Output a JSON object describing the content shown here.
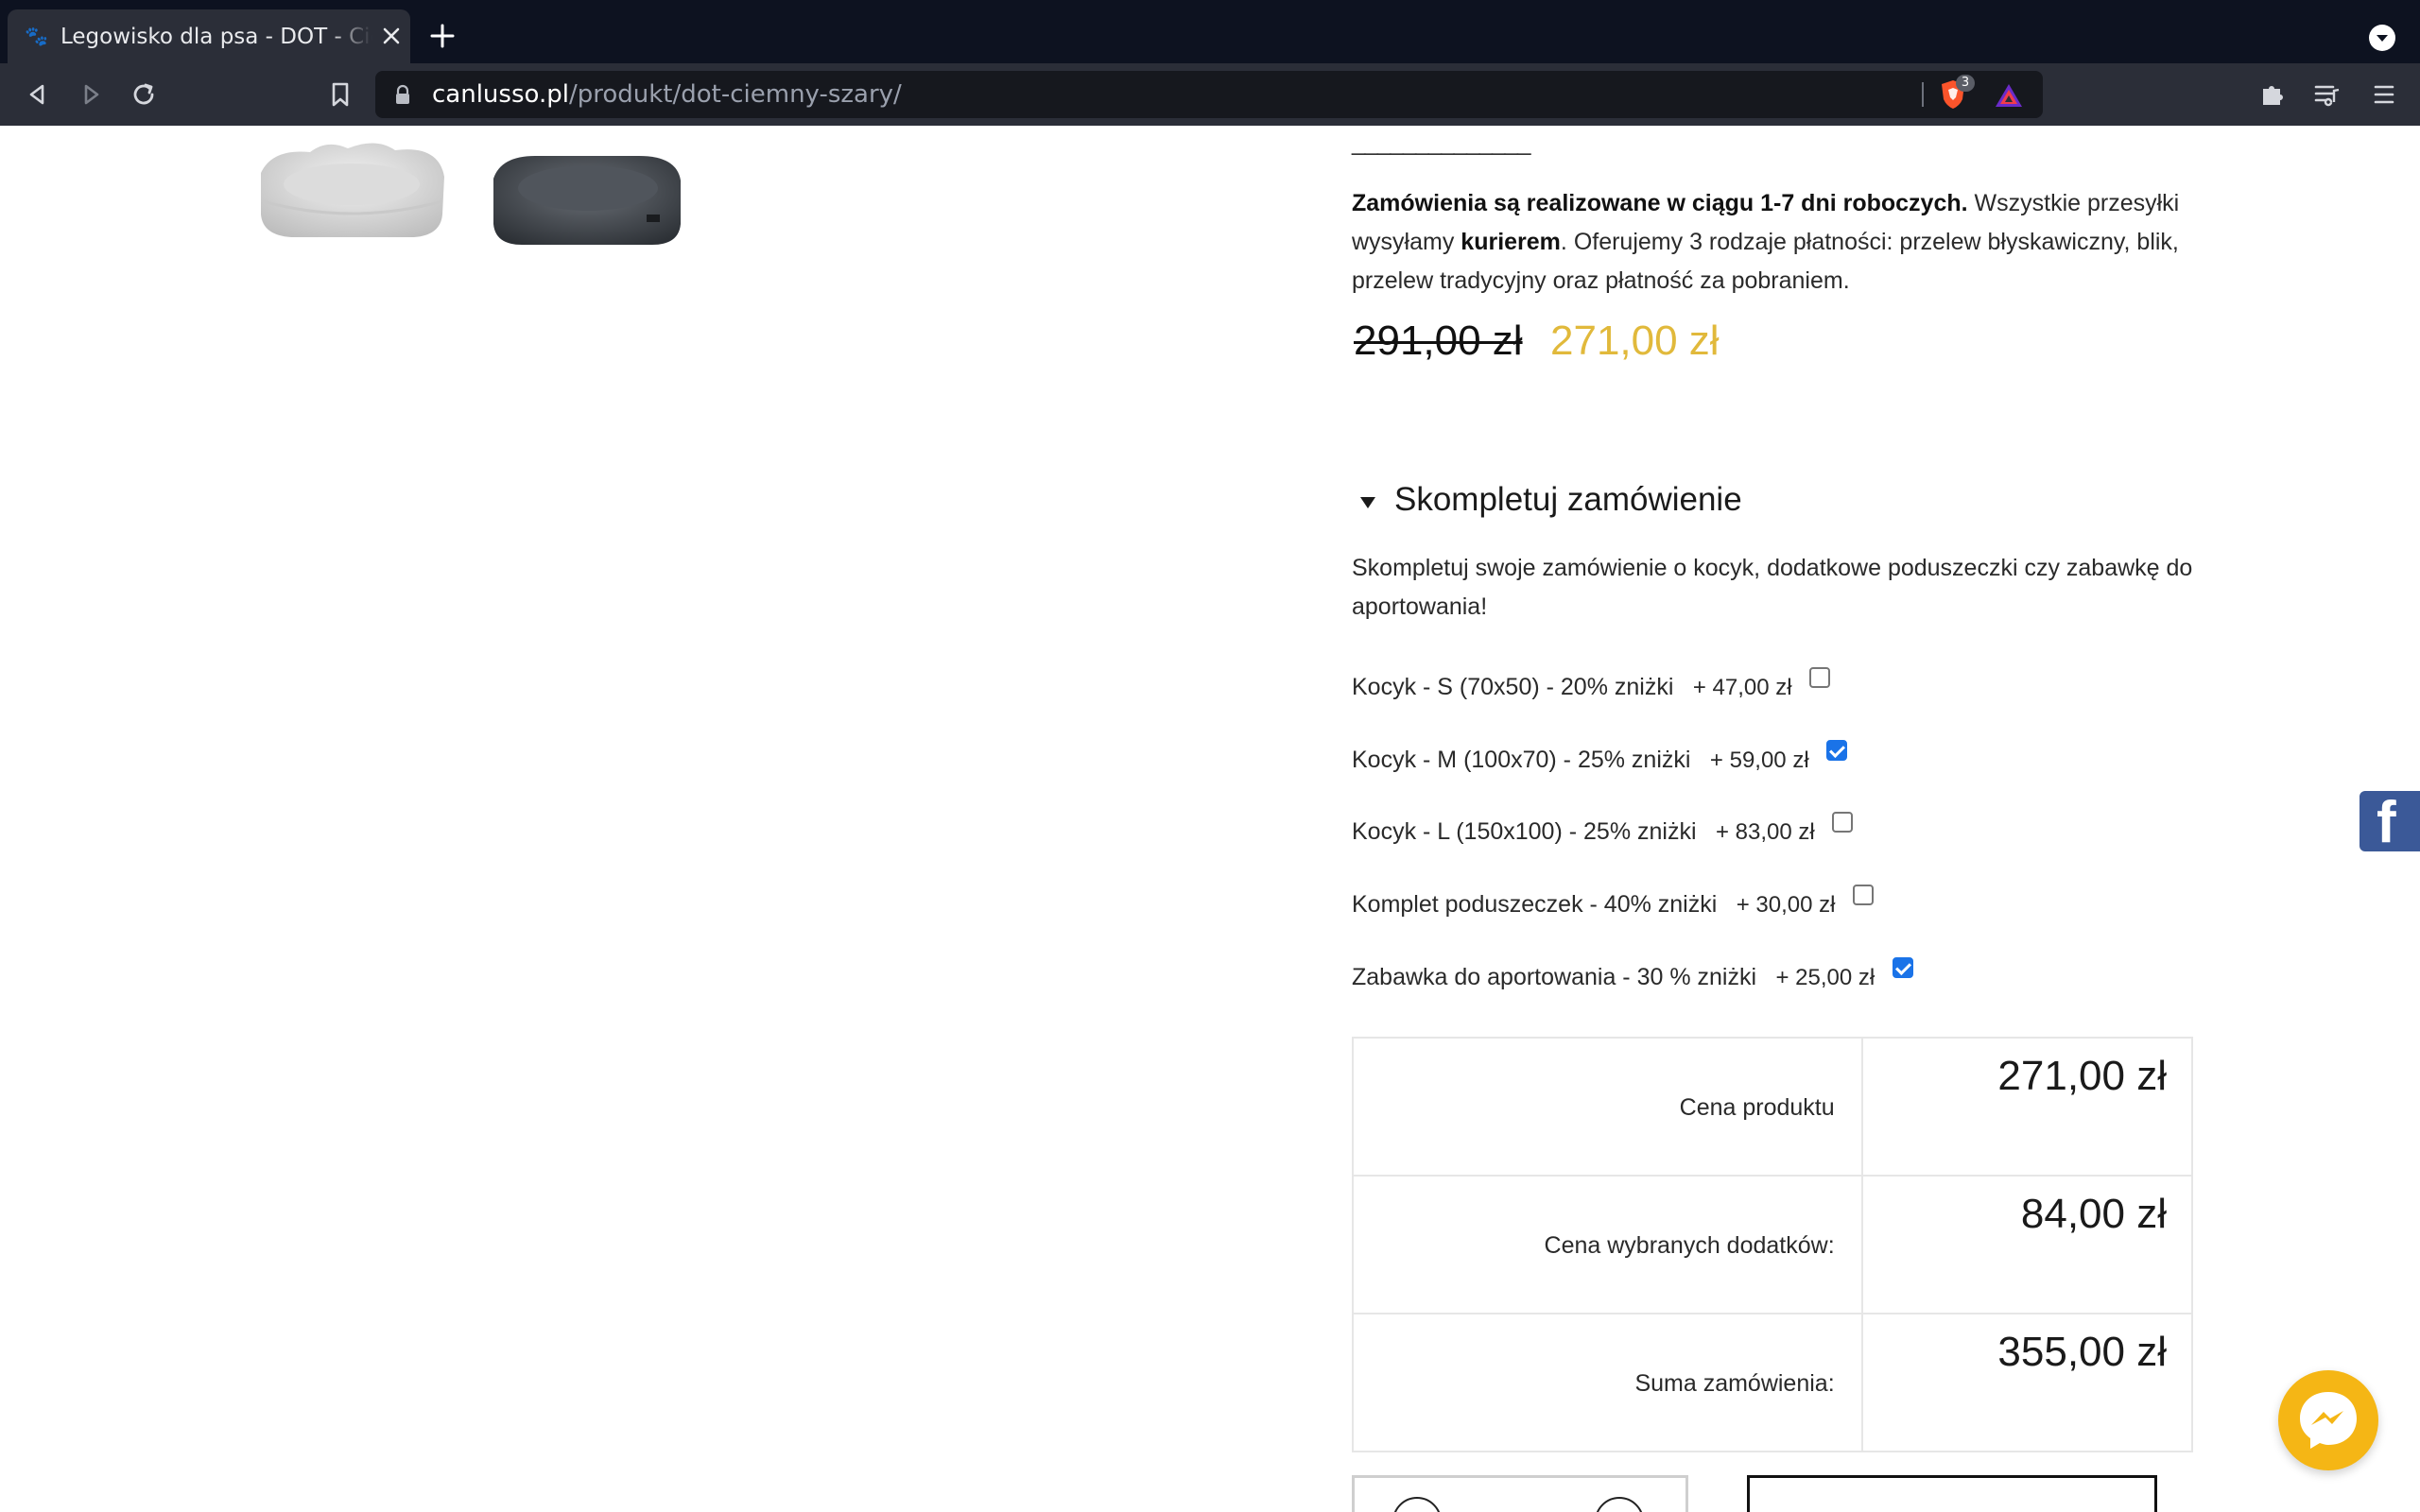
{
  "browser": {
    "tab_title": "Legowisko dla psa - DOT - Ciemny szary",
    "url_host": "canlusso.pl",
    "url_path": "/produkt/dot-ciemny-szary/",
    "shield_count": "3"
  },
  "product": {
    "divider": "______________",
    "shipping_bold_1": "Zamówienia są realizowane w ciągu 1-7 dni roboczych.",
    "shipping_text_1": " Wszystkie przesyłki wysyłamy ",
    "shipping_bold_2": "kurierem",
    "shipping_text_2": ". Oferujemy 3 rodzaje płatności: przelew błyskawiczny, blik, przelew tradycyjny oraz płatność za pobraniem.",
    "old_price": "291,00 zł",
    "new_price": "271,00 zł"
  },
  "addons": {
    "heading": "Skompletuj zamówienie",
    "description": "Skompletuj swoje zamówienie o kocyk, dodatkowe poduszeczki czy zabawkę do aportowania!",
    "items": [
      {
        "label": "Kocyk - S (70x50) - 20% zniżki",
        "price": "+ 47,00 zł",
        "checked": false
      },
      {
        "label": "Kocyk - M (100x70) - 25% zniżki",
        "price": "+ 59,00 zł",
        "checked": true
      },
      {
        "label": "Kocyk - L (150x100) - 25% zniżki",
        "price": "+ 83,00 zł",
        "checked": false
      },
      {
        "label": "Komplet poduszeczek - 40% zniżki",
        "price": "+ 30,00 zł",
        "checked": false
      },
      {
        "label": "Zabawka do aportowania - 30 % zniżki",
        "price": "+ 25,00 zł",
        "checked": true
      }
    ]
  },
  "totals": {
    "product_price_label": "Cena produktu",
    "product_price_value": "271,00 zł",
    "addons_price_label": "Cena wybranych dodatków:",
    "addons_price_value": "84,00 zł",
    "order_total_label": "Suma zamówienia:",
    "order_total_value": "355,00 zł"
  },
  "colors": {
    "sale_price": "#e1b93b",
    "checkbox_checked": "#1a73e8",
    "facebook": "#3b5998",
    "messenger": "#f5b615"
  }
}
